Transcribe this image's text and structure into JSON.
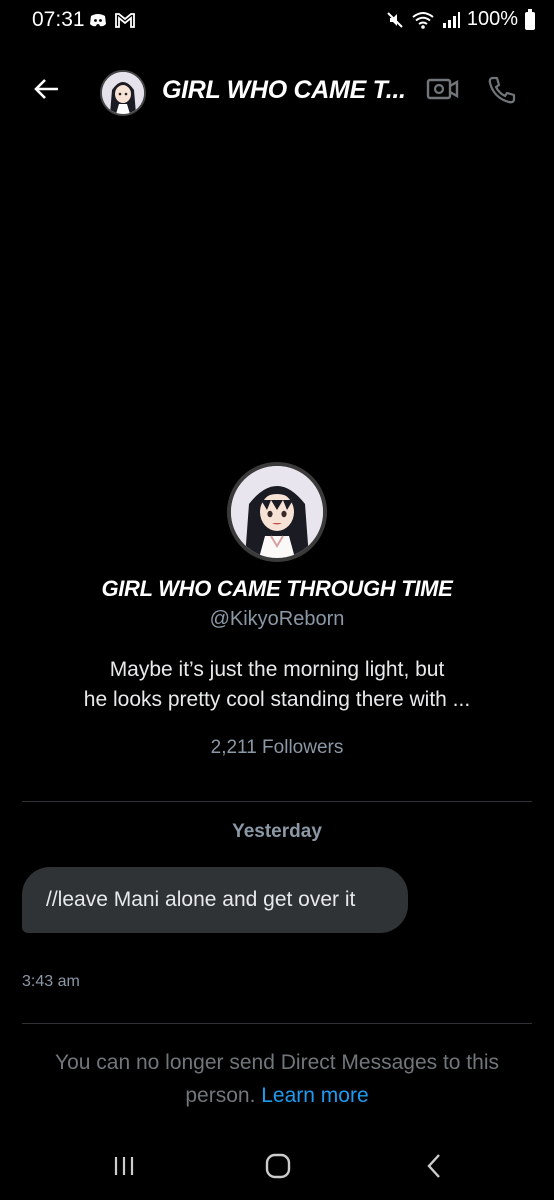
{
  "status_bar": {
    "time": "07:31",
    "battery": "100%",
    "left_icons": [
      "discord-icon",
      "gmail-icon"
    ],
    "right_icons": [
      "mute-icon",
      "wifi-icon",
      "signal-icon",
      "battery-icon"
    ]
  },
  "header": {
    "title": "GIRL WHO CAME T...",
    "icons": [
      "back-arrow-icon",
      "video-call-icon",
      "phone-call-icon"
    ]
  },
  "profile": {
    "name": "GIRL WHO CAME THROUGH TIME",
    "handle": "@KikyoReborn",
    "bio_line1": "Maybe it’s just the morning light, but",
    "bio_line2": "he looks pretty cool standing there with ...",
    "followers": "2,211 Followers"
  },
  "conversation": {
    "day_label": "Yesterday",
    "messages": [
      {
        "text": "//leave Mani alone and get over it",
        "time": "3:43 am"
      }
    ]
  },
  "notice": {
    "text": "You can no longer send Direct Messages to this person.",
    "link": "Learn more"
  },
  "colors": {
    "background": "#000000",
    "bubble": "#2f3336",
    "link": "#1d9bf0",
    "secondary_text": "#8b98a5"
  }
}
